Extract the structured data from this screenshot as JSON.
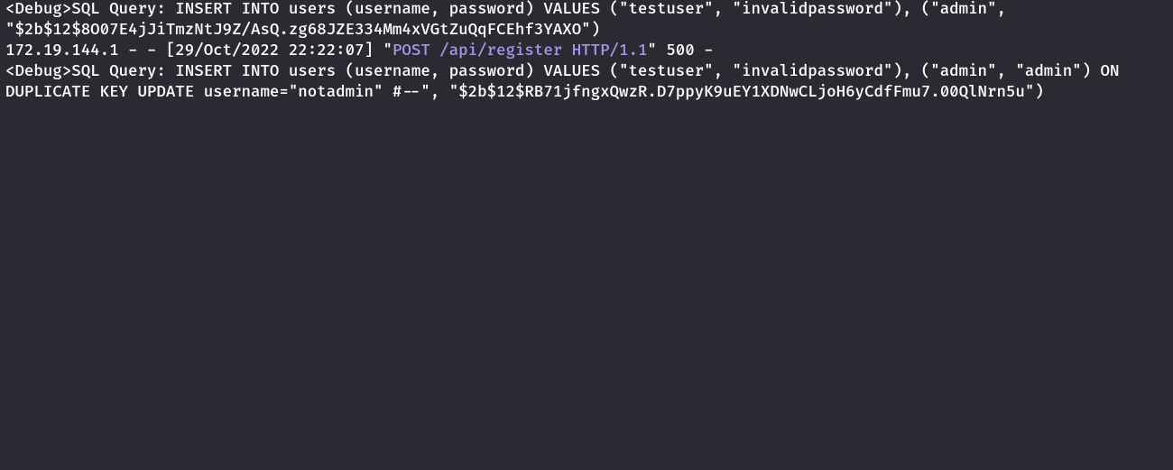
{
  "lines": {
    "line1_prefix": "<Debug>",
    "line1_text": "SQL Query: INSERT INTO users (username, password) VALUES (\"testuser\", \"invalidpassword\"), (\"admin\", \"$2b$12$8O07E4jJiTmzNtJ9Z/AsQ.zg68JZE334Mm4xVGtZuQqFCEhf3YAXO\")",
    "line2_ip": "172.19.144.1 - - [29/Oct/2022 22:22:07] \"",
    "line2_highlight": "POST /api/register HTTP/1.1",
    "line2_suffix": "\" 500 -",
    "line3_prefix": "<Debug>",
    "line3_text": "SQL Query: INSERT INTO users (username, password) VALUES (\"testuser\", \"invalidpassword\"), (\"admin\", \"admin\") ON DUPLICATE KEY UPDATE username=\"notadmin\" #--\", \"$2b$12$RB71jfngxQwzR.D7ppyK9uEY1XDNwCLjoH6yCdfFmu7.00QlNrn5u\")"
  }
}
